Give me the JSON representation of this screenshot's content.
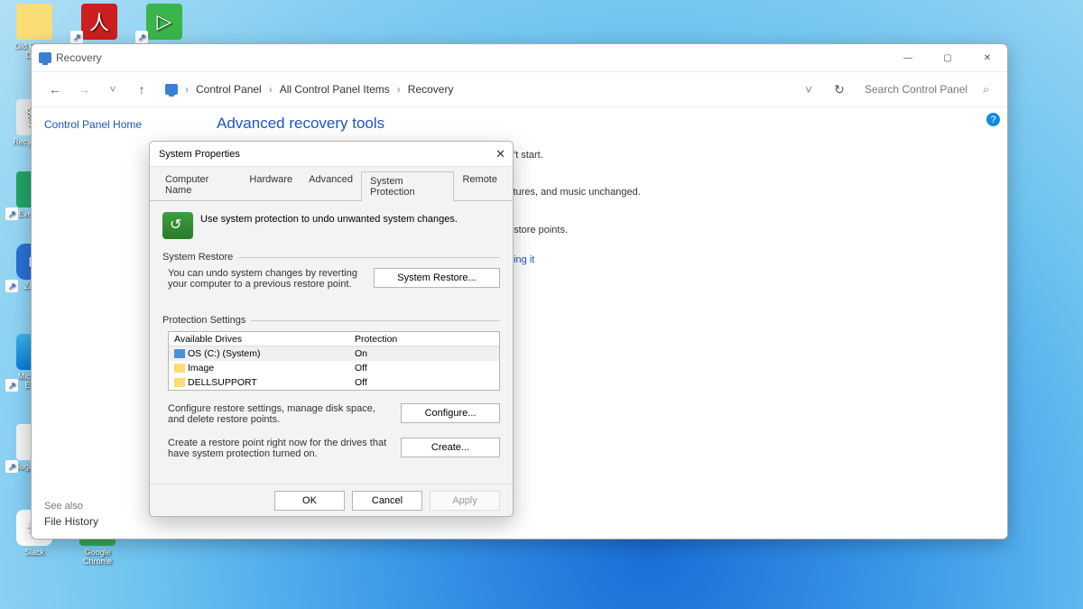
{
  "desktop": {
    "icons": [
      {
        "label": "Old Firefox Data"
      },
      {
        "label": ""
      },
      {
        "label": ""
      },
      {
        "label": "Recycle Bin"
      },
      {
        "label": "Evernote"
      },
      {
        "label": "Zoom"
      },
      {
        "label": "Microsoft Edge"
      },
      {
        "label": "SugarSync"
      },
      {
        "label": "Slack"
      },
      {
        "label": "Google Chrome"
      }
    ]
  },
  "window": {
    "title": "Recovery",
    "breadcrumbs": [
      "Control Panel",
      "All Control Panel Items",
      "Recovery"
    ],
    "search_placeholder": "Search Control Panel",
    "sidebar_home": "Control Panel Home",
    "heading": "Advanced recovery tools",
    "bg_line1_tail": "n't start.",
    "bg_line2_tail": "ctures, and music unchanged.",
    "bg_line3_tail": "estore points.",
    "bg_line4_tail": "tting it",
    "see_also": "See also",
    "file_history": "File History"
  },
  "dialog": {
    "title": "System Properties",
    "tabs": [
      "Computer Name",
      "Hardware",
      "Advanced",
      "System Protection",
      "Remote"
    ],
    "active_tab": "System Protection",
    "intro": "Use system protection to undo unwanted system changes.",
    "group_restore": "System Restore",
    "restore_text": "You can undo system changes by reverting your computer to a previous restore point.",
    "restore_btn": "System Restore...",
    "group_protection": "Protection Settings",
    "table": {
      "headers": [
        "Available Drives",
        "Protection"
      ],
      "rows": [
        {
          "drive": "OS (C:) (System)",
          "protection": "On",
          "icon": "disk"
        },
        {
          "drive": "Image",
          "protection": "Off",
          "icon": "folder"
        },
        {
          "drive": "DELLSUPPORT",
          "protection": "Off",
          "icon": "folder"
        }
      ]
    },
    "configure_text": "Configure restore settings, manage disk space, and delete restore points.",
    "configure_btn": "Configure...",
    "create_text": "Create a restore point right now for the drives that have system protection turned on.",
    "create_btn": "Create...",
    "ok": "OK",
    "cancel": "Cancel",
    "apply": "Apply"
  }
}
